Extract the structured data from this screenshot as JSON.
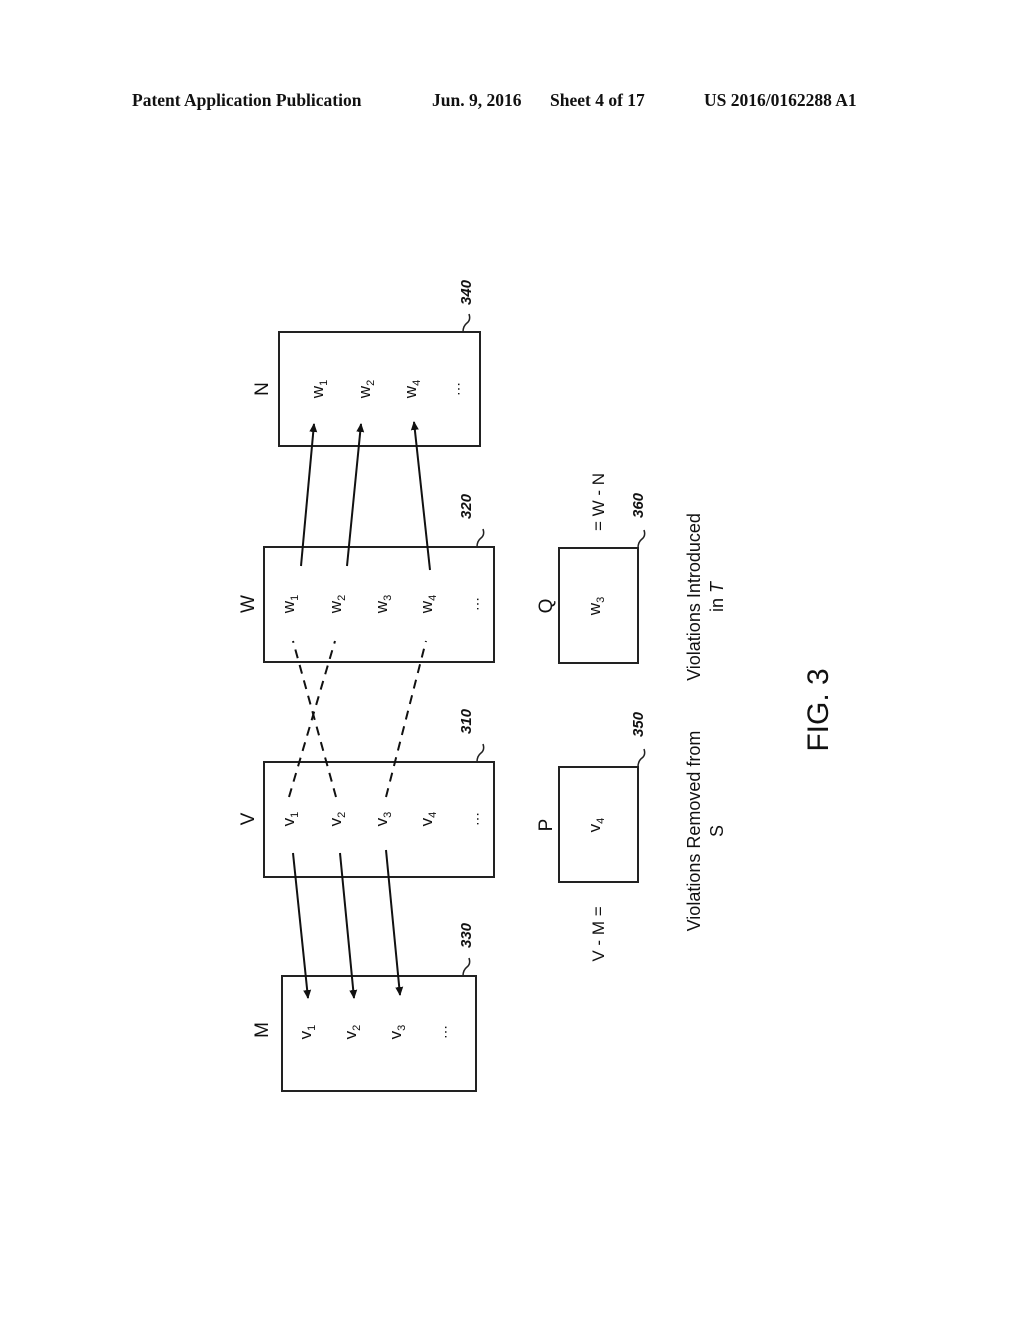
{
  "header": {
    "left": "Patent Application Publication",
    "date": "Jun. 9, 2016",
    "sheet": "Sheet 4 of 17",
    "pub_number": "US 2016/0162288 A1"
  },
  "figure": {
    "caption": "FIG. 3",
    "boxes": {
      "M": {
        "title": "M",
        "ref": "330",
        "items": [
          "v",
          "v",
          "v",
          "..."
        ],
        "subs": [
          "1",
          "2",
          "3",
          ""
        ]
      },
      "V": {
        "title": "V",
        "ref": "310",
        "items": [
          "v",
          "v",
          "v",
          "v",
          "..."
        ],
        "subs": [
          "1",
          "2",
          "3",
          "4",
          ""
        ]
      },
      "W": {
        "title": "W",
        "ref": "320",
        "items": [
          "w",
          "w",
          "w",
          "w",
          "..."
        ],
        "subs": [
          "1",
          "2",
          "3",
          "4",
          ""
        ]
      },
      "N": {
        "title": "N",
        "ref": "340",
        "items": [
          "w",
          "w",
          "w",
          "..."
        ],
        "subs": [
          "1",
          "2",
          "4",
          ""
        ]
      },
      "P": {
        "title": "P",
        "ref": "350",
        "items": [
          "v"
        ],
        "subs": [
          "4"
        ]
      },
      "Q": {
        "title": "Q",
        "ref": "360",
        "items": [
          "w"
        ],
        "subs": [
          "3"
        ]
      }
    },
    "equations": {
      "p_eq": "V - M =",
      "q_eq": "= W - N"
    },
    "notes": {
      "removed_line1": "Violations Removed from",
      "removed_line2": "S",
      "introduced_line1": "Violations Introduced",
      "introduced_line2_prefix": "in ",
      "introduced_line2_var": "T"
    }
  }
}
